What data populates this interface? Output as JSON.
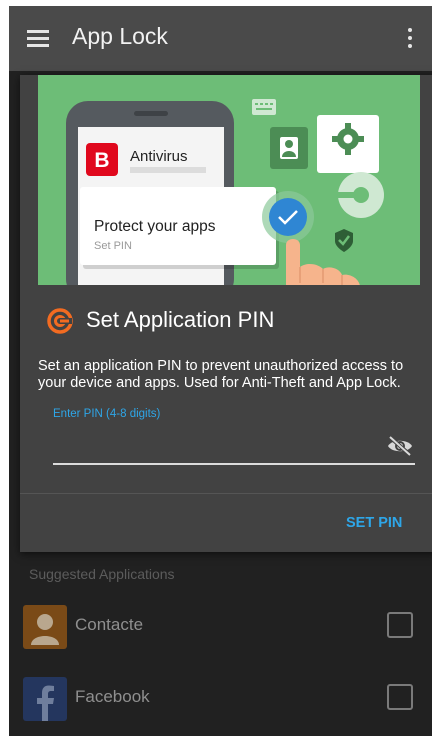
{
  "app_bar": {
    "title": "App Lock",
    "menu_icon": "hamburger-menu-icon",
    "overflow_icon": "more-vertical-icon",
    "background": "#4a4a4a"
  },
  "dialog": {
    "hero": {
      "brand_letter": "B",
      "app_name": "Antivirus",
      "card_title": "Protect your apps",
      "card_subtitle": "Set PIN",
      "background": "#6dbd77",
      "brand_color": "#e0081d"
    },
    "title": "Set Application PIN",
    "icon": "bitdefender-logo-icon",
    "description": "Set an application PIN to prevent unauthorized access to your device and apps. Used for Anti-Theft and App Lock.",
    "pin_field": {
      "label": "Enter PIN (4-8 digits)",
      "value": "",
      "visibility_icon": "eye-off-icon"
    },
    "action_button": "SET PIN",
    "accent": "#2ea6e8",
    "brand_orange": "#f26b21"
  },
  "suggested": {
    "title": "Suggested Applications",
    "apps": [
      {
        "name": "Contacte",
        "icon": "contacts-app-icon",
        "checked": false
      },
      {
        "name": "Facebook",
        "icon": "facebook-app-icon",
        "checked": false
      }
    ]
  }
}
